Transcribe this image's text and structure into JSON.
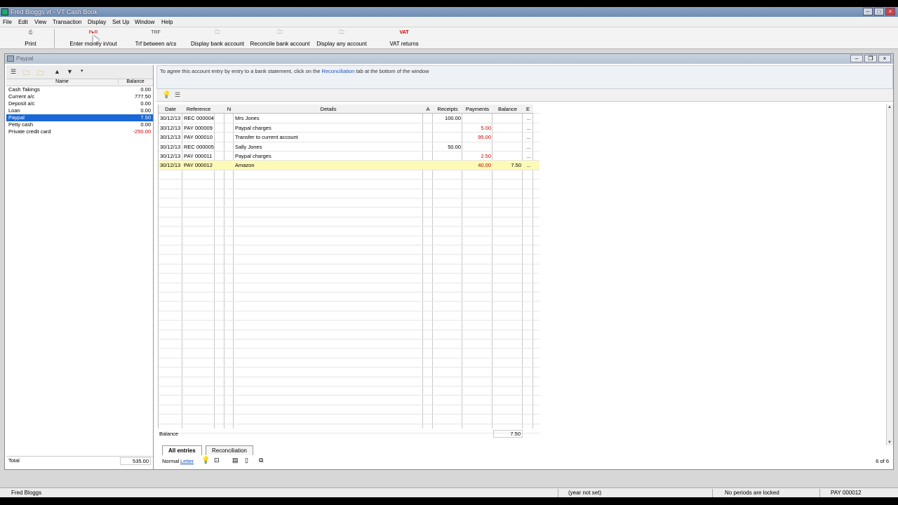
{
  "window": {
    "title": "Fred Bloggs.vt - VT Cash Book"
  },
  "menu": [
    "File",
    "Edit",
    "View",
    "Transaction",
    "Display",
    "Set Up",
    "Window",
    "Help"
  ],
  "toolbar": [
    {
      "icon": "print-icon",
      "glyph": "⎙",
      "label": "Print"
    },
    {
      "icon": "money-in-out-icon",
      "glyph": "P▸R",
      "label": "Enter money in/out"
    },
    {
      "icon": "transfer-icon",
      "glyph": "TRF",
      "label": "Trf between a/cs"
    },
    {
      "icon": "bank-display-icon",
      "glyph": "🗀",
      "label": "Display bank account"
    },
    {
      "icon": "reconcile-icon",
      "glyph": "🗀",
      "label": "Reconcile bank account"
    },
    {
      "icon": "any-account-icon",
      "glyph": "🗀",
      "label": "Display any account"
    },
    {
      "icon": "vat-icon",
      "glyph": "VAT",
      "label": "VAT returns"
    }
  ],
  "child": {
    "title": "Paypal"
  },
  "accounts": {
    "headers": {
      "name": "Name",
      "balance": "Balance"
    },
    "rows": [
      {
        "name": "Cash Takings",
        "balance": "0.00",
        "neg": false,
        "sel": false
      },
      {
        "name": "Current a/c",
        "balance": "777.50",
        "neg": false,
        "sel": false
      },
      {
        "name": "Deposit a/c",
        "balance": "0.00",
        "neg": false,
        "sel": false
      },
      {
        "name": "Loan",
        "balance": "0.00",
        "neg": false,
        "sel": false
      },
      {
        "name": "Paypal",
        "balance": "7.50",
        "neg": false,
        "sel": true
      },
      {
        "name": "Petty cash",
        "balance": "0.00",
        "neg": false,
        "sel": false
      },
      {
        "name": "Private credit card",
        "balance": "-250.00",
        "neg": true,
        "sel": false
      }
    ],
    "total_label": "Total",
    "total_value": "535.00"
  },
  "info": {
    "text_before": "To agree this account entry by entry to a bank statement, click on the ",
    "link": "Reconciliation",
    "text_after": " tab at the bottom of the window"
  },
  "ledger": {
    "headers": [
      "Date",
      "Reference",
      "N",
      "Details",
      "A",
      "Receipts",
      "Payments",
      "Balance",
      "E"
    ],
    "rows": [
      {
        "date": "30/12/13",
        "ref": "REC 000004",
        "n": "",
        "details": "Mrs Jones",
        "a": "",
        "receipts": "100.00",
        "payments": "",
        "balance": "",
        "e": "..."
      },
      {
        "date": "30/12/13",
        "ref": "PAY 000009",
        "n": "",
        "details": "Paypal charges",
        "a": "",
        "receipts": "",
        "payments": "5.00",
        "balance": "",
        "e": "..."
      },
      {
        "date": "30/12/13",
        "ref": "PAY 000010",
        "n": "",
        "details": "Transfer to current account",
        "a": "",
        "receipts": "",
        "payments": "95.00",
        "balance": "",
        "e": "..."
      },
      {
        "date": "30/12/13",
        "ref": "REC 000005",
        "n": "",
        "details": "Sally Jones",
        "a": "",
        "receipts": "50.00",
        "payments": "",
        "balance": "",
        "e": "..."
      },
      {
        "date": "30/12/13",
        "ref": "PAY 000011",
        "n": "",
        "details": "Paypal charges",
        "a": "",
        "receipts": "",
        "payments": "2.50",
        "balance": "",
        "e": "..."
      },
      {
        "date": "30/12/13",
        "ref": "PAY 000012",
        "n": "",
        "details": "Amazon",
        "a": "",
        "receipts": "",
        "payments": "40.00",
        "balance": "7.50",
        "e": "..."
      }
    ],
    "selected_index": 5,
    "balance_label": "Balance",
    "balance_value": "7.50"
  },
  "tabs": [
    "All entries",
    "Reconciliation"
  ],
  "bottom": {
    "view": "Normal",
    "paper": "Letter",
    "count": "6 of 6"
  },
  "status": {
    "user": "Fred Bloggs",
    "year": "(year not set)",
    "periods": "No periods are locked",
    "ref": "PAY 000012"
  }
}
